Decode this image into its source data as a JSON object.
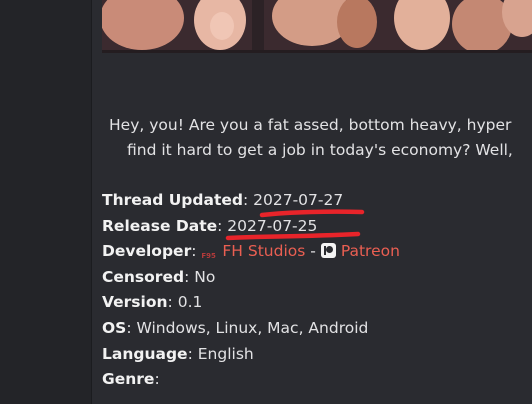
{
  "banner": {
    "icon": "artwork-banner-image"
  },
  "intro": {
    "line1": "Hey, you! Are you a fat assed, bottom heavy, hyper",
    "line2": "find it hard to get a job in today's economy? Well,"
  },
  "meta": {
    "thread_updated_label": "Thread Updated",
    "thread_updated_value": "2027-07-27",
    "release_date_label": "Release Date",
    "release_date_value": "2027-07-25",
    "developer_label": "Developer",
    "developer_f95_badge": "F95",
    "developer_name": "FH Studios",
    "developer_separator": "-",
    "developer_patreon": "Patreon",
    "censored_label": "Censored",
    "censored_value": "No",
    "version_label": "Version",
    "version_value": "0.1",
    "os_label": "OS",
    "os_value": "Windows, Linux, Mac, Android",
    "language_label": "Language",
    "language_value": "English",
    "genre_label": "Genre",
    "genre_value": "",
    "colon": ":"
  },
  "colors": {
    "background": "#2a2b30",
    "sidebar": "#232428",
    "link": "#ea5f52",
    "annotation": "#e8242a"
  }
}
